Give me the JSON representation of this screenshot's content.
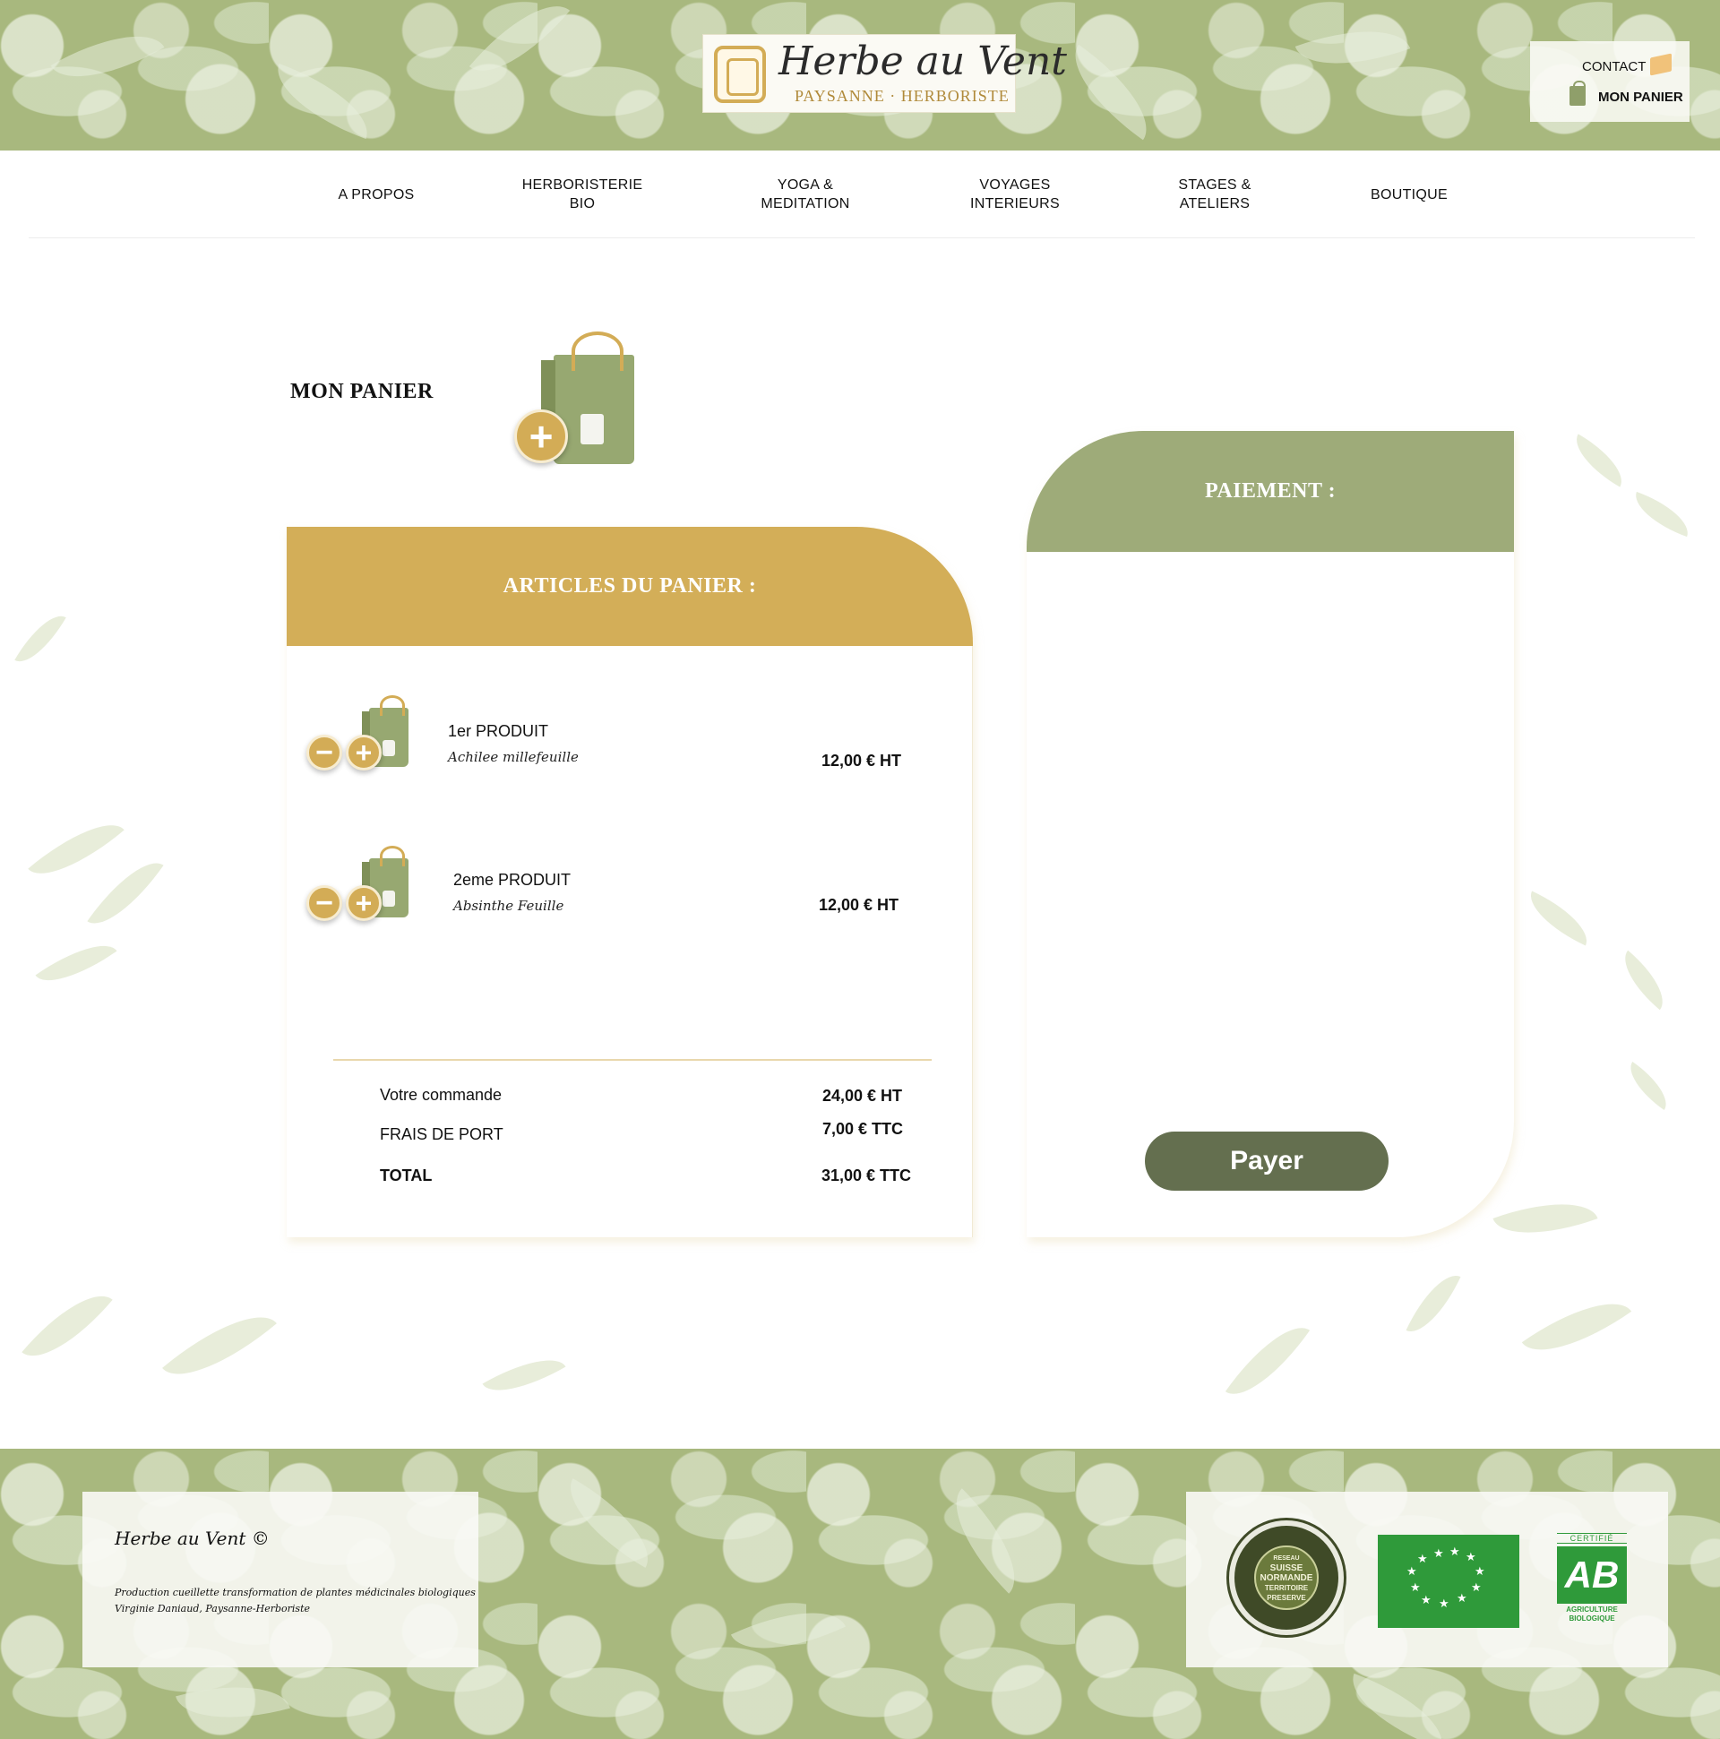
{
  "brand": {
    "name": "Herbe au Vent",
    "tagline": "PAYSANNE · HERBORISTE"
  },
  "utility": {
    "contact": "CONTACT",
    "cart": "MON PANIER"
  },
  "nav": [
    {
      "line1": "A PROPOS",
      "line2": ""
    },
    {
      "line1": "HERBORISTERIE",
      "line2": "BIO"
    },
    {
      "line1": "YOGA &",
      "line2": "MEDITATION"
    },
    {
      "line1": "VOYAGES",
      "line2": "INTERIEURS"
    },
    {
      "line1": "STAGES &",
      "line2": "ATELIERS"
    },
    {
      "line1": "BOUTIQUE",
      "line2": ""
    }
  ],
  "page": {
    "title": "MON PANIER"
  },
  "cart": {
    "header": "ARTICLES DU PANIER :",
    "items": [
      {
        "name": "1er PRODUIT",
        "subtitle": "Achilee millefeuille",
        "price": "12,00 € HT"
      },
      {
        "name": "2eme PRODUIT",
        "subtitle": "Absinthe Feuille",
        "price": "12,00 € HT"
      }
    ],
    "summary": {
      "order_label": "Votre commande",
      "order_value": "24,00 € HT",
      "shipping_label": "FRAIS DE PORT",
      "shipping_value": "7,00 € TTC",
      "total_label": "TOTAL",
      "total_value": "31,00 € TTC"
    }
  },
  "payment": {
    "header": "PAIEMENT :",
    "button": "Payer"
  },
  "footer": {
    "brand": "Herbe au Vent ©",
    "line1": "Production cueillette transformation de plantes médicinales biologiques",
    "line2": "Virginie Daniaud, Paysanne-Herboriste",
    "seal_text": [
      "RESEAU",
      "SUISSE",
      "NORMANDE",
      "TERRITOIRE",
      "PRESERVE"
    ],
    "ab_top": "CERTIFIÉ",
    "ab_mark": "AB",
    "ab_bottom": [
      "AGRICULTURE",
      "BIOLOGIQUE"
    ]
  },
  "colors": {
    "gold": "#d3ae58",
    "sage": "#9eab79",
    "dark_olive": "#646f4f",
    "pattern_green": "#a8b87e"
  },
  "icons": [
    "envelope-icon",
    "shopping-bag-icon",
    "plus-icon",
    "minus-icon",
    "bio-seal-icon",
    "eu-organic-leaf-icon",
    "ab-certification-icon"
  ]
}
